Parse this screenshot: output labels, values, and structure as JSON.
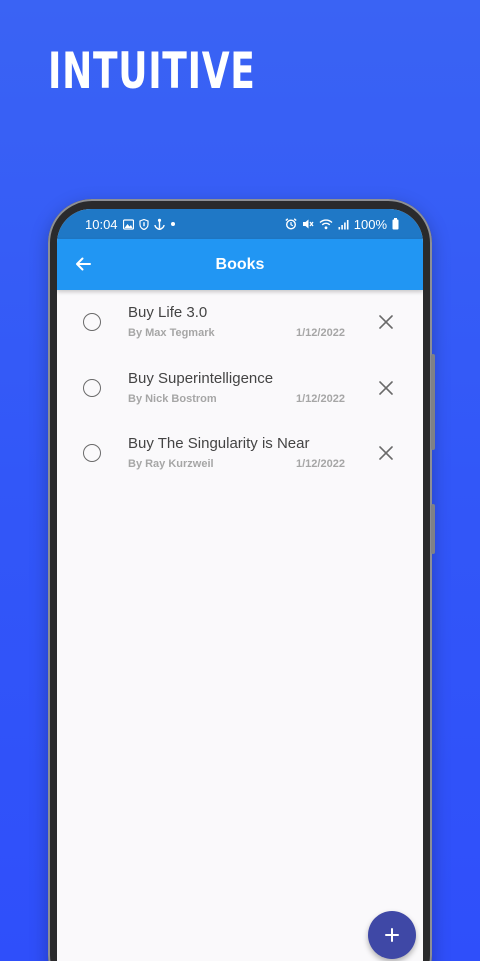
{
  "headline": "INTUITIVE",
  "status_bar": {
    "time": "10:04",
    "battery": "100%",
    "left_icons": [
      "image-icon",
      "shield-icon",
      "anchor-icon",
      "dot-icon"
    ],
    "right_icons": [
      "alarm-icon",
      "mute-icon",
      "wifi-icon",
      "signal-icon",
      "battery-icon"
    ]
  },
  "app_bar": {
    "title": "Books",
    "back_icon": "arrow-left-icon"
  },
  "items": [
    {
      "title": "Buy Life 3.0",
      "subtitle": "By Max Tegmark",
      "date": "1/12/2022",
      "checked": false
    },
    {
      "title": "Buy Superintelligence",
      "subtitle": "By Nick Bostrom",
      "date": "1/12/2022",
      "checked": false
    },
    {
      "title": "Buy The Singularity is Near",
      "subtitle": "By Ray Kurzweil",
      "date": "1/12/2022",
      "checked": false
    }
  ],
  "fab": {
    "icon": "plus-icon"
  },
  "colors": {
    "background": "#3257f8",
    "status_bar": "#1f78c6",
    "app_bar": "#2196f3",
    "fab": "#3f48a6"
  }
}
